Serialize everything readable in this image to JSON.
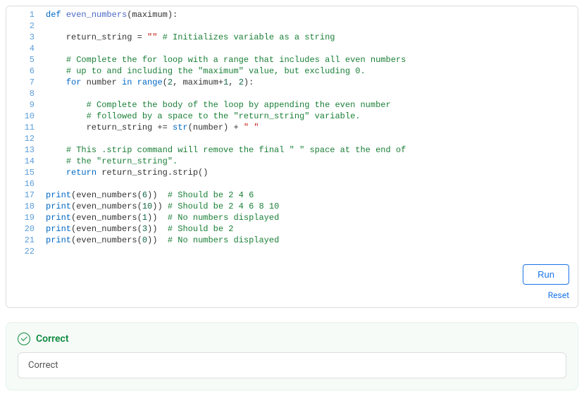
{
  "code": {
    "lines": [
      [
        [
          "kw",
          "def "
        ],
        [
          "fndef",
          "even_numbers"
        ],
        [
          "pn",
          "(maximum):"
        ]
      ],
      [],
      [
        [
          "pn",
          "    return_string = "
        ],
        [
          "str",
          "\"\""
        ],
        [
          "pn",
          " "
        ],
        [
          "cm",
          "# Initializes variable as a string"
        ]
      ],
      [],
      [
        [
          "pn",
          "    "
        ],
        [
          "cm",
          "# Complete the for loop with a range that includes all even numbers"
        ]
      ],
      [
        [
          "pn",
          "    "
        ],
        [
          "cm",
          "# up to and including the \"maximum\" value, but excluding 0."
        ]
      ],
      [
        [
          "pn",
          "    "
        ],
        [
          "kw",
          "for "
        ],
        [
          "pn",
          "number "
        ],
        [
          "kw",
          "in "
        ],
        [
          "bi",
          "range"
        ],
        [
          "pn",
          "("
        ],
        [
          "num",
          "2"
        ],
        [
          "pn",
          ", maximum+"
        ],
        [
          "num",
          "1"
        ],
        [
          "pn",
          ", "
        ],
        [
          "num",
          "2"
        ],
        [
          "pn",
          "):"
        ]
      ],
      [],
      [
        [
          "pn",
          "        "
        ],
        [
          "cm",
          "# Complete the body of the loop by appending the even number"
        ]
      ],
      [
        [
          "pn",
          "        "
        ],
        [
          "cm",
          "# followed by a space to the \"return_string\" variable."
        ]
      ],
      [
        [
          "pn",
          "        return_string += "
        ],
        [
          "bi",
          "str"
        ],
        [
          "pn",
          "(number) + "
        ],
        [
          "str",
          "\" \""
        ]
      ],
      [],
      [
        [
          "pn",
          "    "
        ],
        [
          "cm",
          "# This .strip command will remove the final \" \" space at the end of"
        ]
      ],
      [
        [
          "pn",
          "    "
        ],
        [
          "cm",
          "# the \"return_string\"."
        ]
      ],
      [
        [
          "pn",
          "    "
        ],
        [
          "kw",
          "return "
        ],
        [
          "pn",
          "return_string.strip()"
        ]
      ],
      [],
      [
        [
          "bi",
          "print"
        ],
        [
          "pn",
          "(even_numbers("
        ],
        [
          "num",
          "6"
        ],
        [
          "pn",
          "))  "
        ],
        [
          "cm",
          "# Should be 2 4 6"
        ]
      ],
      [
        [
          "bi",
          "print"
        ],
        [
          "pn",
          "(even_numbers("
        ],
        [
          "num",
          "10"
        ],
        [
          "pn",
          ")) "
        ],
        [
          "cm",
          "# Should be 2 4 6 8 10"
        ]
      ],
      [
        [
          "bi",
          "print"
        ],
        [
          "pn",
          "(even_numbers("
        ],
        [
          "num",
          "1"
        ],
        [
          "pn",
          "))  "
        ],
        [
          "cm",
          "# No numbers displayed"
        ]
      ],
      [
        [
          "bi",
          "print"
        ],
        [
          "pn",
          "(even_numbers("
        ],
        [
          "num",
          "3"
        ],
        [
          "pn",
          "))  "
        ],
        [
          "cm",
          "# Should be 2"
        ]
      ],
      [
        [
          "bi",
          "print"
        ],
        [
          "pn",
          "(even_numbers("
        ],
        [
          "num",
          "0"
        ],
        [
          "pn",
          "))  "
        ],
        [
          "cm",
          "# No numbers displayed"
        ]
      ],
      []
    ]
  },
  "buttons": {
    "run": "Run",
    "reset": "Reset"
  },
  "result": {
    "status_label": "Correct",
    "output_text": "Correct"
  }
}
